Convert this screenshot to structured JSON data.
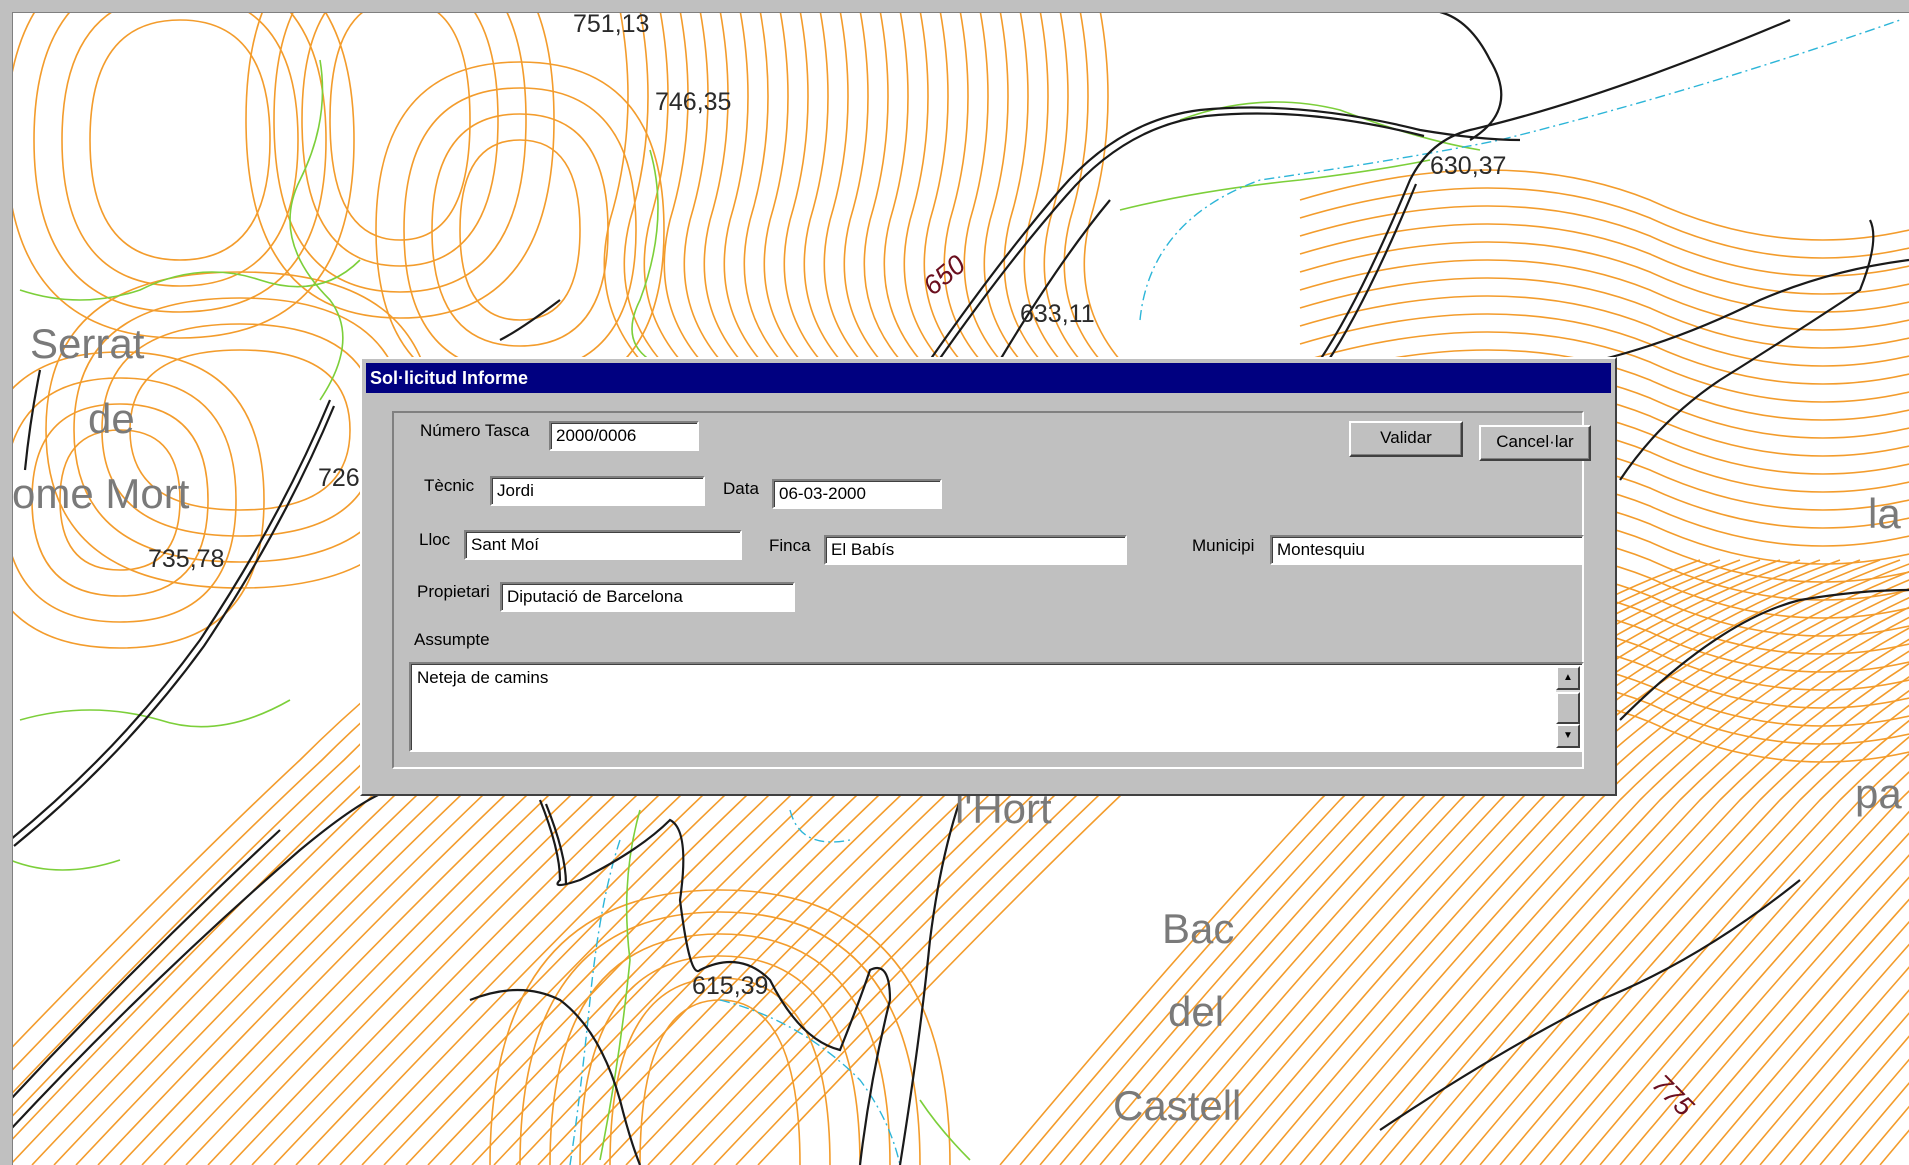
{
  "map": {
    "place_names": [
      "Serrat",
      "de",
      "ome Mort",
      "l'Hort",
      "Bac",
      "del",
      "Castell",
      "la",
      "pa"
    ],
    "spot_heights": [
      "751,13",
      "746,35",
      "630,37",
      "633,11",
      "726",
      "735,78",
      "615,39"
    ],
    "contour_labels": [
      "650",
      "775"
    ]
  },
  "dialog": {
    "title": "Sol·licitud Informe",
    "numero_tasca_label": "Número Tasca",
    "numero_tasca_value": "2000/0006",
    "validar_button": "Validar",
    "cancel_button": "Cancel·lar",
    "tecnic_label": "Tècnic",
    "tecnic_value": "Jordi",
    "data_label": "Data",
    "data_value": "06-03-2000",
    "lloc_label": "Lloc",
    "lloc_value": "Sant Moí",
    "finca_label": "Finca",
    "finca_value": "El Babís",
    "municipi_label": "Municipi",
    "municipi_value": "Montesquiu",
    "propietari_label": "Propietari",
    "propietari_value": "Diputació de Barcelona",
    "assumpte_label": "Assumpte",
    "assumpte_value": "Neteja de camins"
  },
  "colors": {
    "contour": "#f39c2c",
    "vegetation": "#7ccf3a",
    "road": "#1a1a1a",
    "stream": "#2cb5d8",
    "titlebar": "#000080"
  }
}
